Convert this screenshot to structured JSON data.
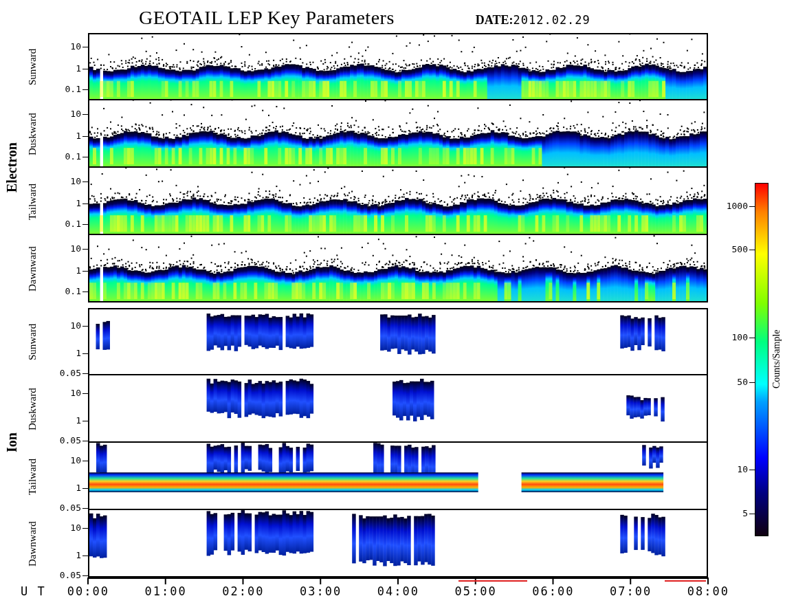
{
  "title": "GEOTAIL LEP Key Parameters",
  "date_label": "DATE:",
  "date": "2012.02.29",
  "groups": [
    {
      "label": "Electron",
      "kind": "electron",
      "panels": [
        {
          "label": "Sunward",
          "yticks": [
            "10",
            "1",
            "0.1"
          ]
        },
        {
          "label": "Duskward",
          "yticks": [
            "10",
            "1",
            "0.1"
          ]
        },
        {
          "label": "Tailward",
          "yticks": [
            "10",
            "1",
            "0.1"
          ]
        },
        {
          "label": "Dawnward",
          "yticks": [
            "10",
            "1",
            "0.1"
          ]
        }
      ]
    },
    {
      "label": "Ion",
      "kind": "ion",
      "panels": [
        {
          "label": "Sunward",
          "yticks": [
            "10",
            "1",
            "0.05"
          ]
        },
        {
          "label": "Duskward",
          "yticks": [
            "10",
            "1",
            "0.05"
          ]
        },
        {
          "label": "Tailward",
          "yticks": [
            "10",
            "1",
            "0.05"
          ]
        },
        {
          "label": "Dawnward",
          "yticks": [
            "10",
            "1",
            "0.05"
          ]
        }
      ]
    }
  ],
  "x_axis": {
    "label": "U T",
    "ticks": [
      "00:00",
      "01:00",
      "02:00",
      "03:00",
      "04:00",
      "05:00",
      "06:00",
      "07:00",
      "08:00"
    ]
  },
  "colorbar": {
    "label": "Counts/Sample",
    "ticks": [
      "1000",
      "500",
      "100",
      "50",
      "10",
      "5"
    ]
  }
}
